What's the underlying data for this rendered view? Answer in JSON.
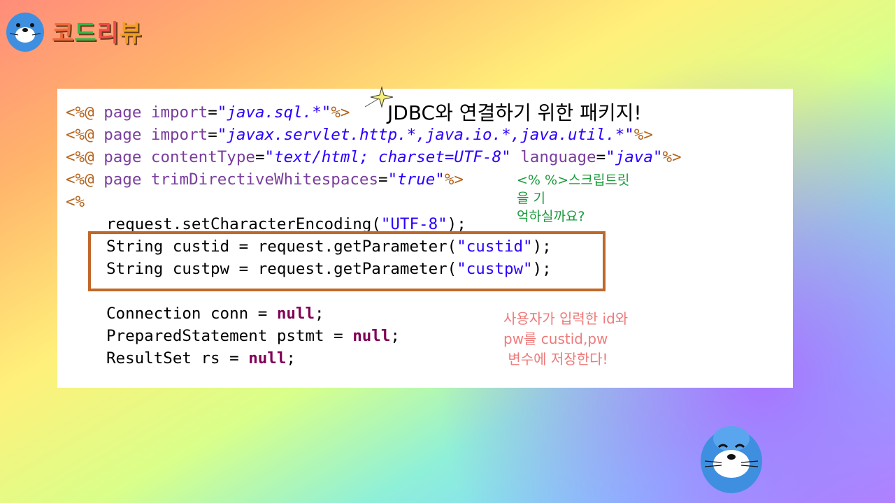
{
  "brand": {
    "t1": "코",
    "t2": "드",
    "t3": "리",
    "t4": "뷰"
  },
  "code": {
    "l1": {
      "tag_open": "<%@",
      "kw": "page",
      "attr": "import",
      "eq": "=",
      "val": "\"java.sql.*\"",
      "tag_close": "%>"
    },
    "l2": {
      "tag_open": "<%@",
      "kw": "page",
      "attr": "import",
      "eq": "=",
      "val": "\"javax.servlet.http.*,java.io.*,java.util.*\"",
      "tag_close": "%>"
    },
    "l3": {
      "tag_open": "<%@",
      "kw": "page",
      "attr1": "contentType",
      "eq1": "=",
      "val1": "\"text/html; charset=UTF-8\"",
      "attr2": "language",
      "eq2": "=",
      "val2": "\"java\"",
      "tag_close": "%>"
    },
    "l4": {
      "tag_open": "<%@",
      "kw": "page",
      "attr": "trimDirectiveWhitespaces",
      "eq": "=",
      "val": "\"true\"",
      "tag_close": "%>"
    },
    "l5": "<%",
    "l6": {
      "pre": "request.setCharacterEncoding(",
      "str": "\"UTF-8\"",
      "post": ");"
    },
    "l7": {
      "pre": "String custid = request.getParameter(",
      "str": "\"custid\"",
      "post": ");"
    },
    "l8": {
      "pre": "String custpw = request.getParameter(",
      "str": "\"custpw\"",
      "post": ");"
    },
    "l9": {
      "pre": "Connection conn = ",
      "kw": "null",
      "post": ";"
    },
    "l10": {
      "pre": "PreparedStatement pstmt = ",
      "kw": "null",
      "post": ";"
    },
    "l11": {
      "pre": "ResultSet rs = ",
      "kw": "null",
      "post": ";"
    }
  },
  "callouts": {
    "jdbc": "JDBC와 연결하기 위한 패키지!",
    "scriptlet_1": "<% %>스크립트릿",
    "scriptlet_2": "을 기",
    "scriptlet_3": "억하실까요?",
    "var_1": "사용자가 입력한 id와",
    "var_2": "pw를 custid,pw",
    "var_3": " 변수에 저장한다!"
  },
  "colors": {
    "highlight_border": "#c0682a",
    "scriptlet_note": "#1a9a3a",
    "var_note": "#ee7a7a"
  },
  "icons": {
    "logo": "seal-mascot-icon",
    "star": "sparkle-star-icon",
    "mascot": "seal-mascot-icon"
  }
}
